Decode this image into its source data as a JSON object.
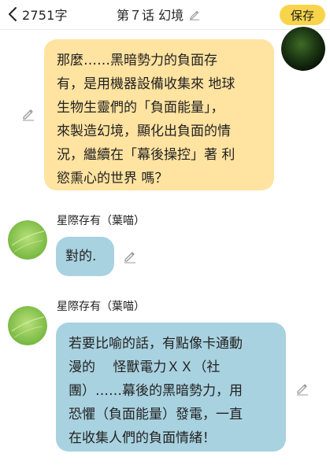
{
  "header": {
    "char_count": "2751字",
    "title": "第７话 幻境",
    "save_label": "保存"
  },
  "messages": [
    {
      "side": "right",
      "text": "那麼……黑暗勢力的負面存\n有，是用機器設備收集來 地球\n生物生靈們的「負面能量」，\n來製造幻境，顯化出負面的情\n況，繼續在「幕後操控」著 利\n慾熏心的世界 嗎？"
    },
    {
      "side": "left",
      "sender": "星際存有（葉喵）",
      "text": "對的."
    },
    {
      "side": "left",
      "sender": "星際存有（葉喵）",
      "text": "若要比喻的話，有點像卡通動\n漫的　 怪獸電力ＸＸ（社\n團）……幕後的黑暗勢力，用\n恐懼（負面能量）發電，一直\n在收集人們的負面情緒！"
    }
  ],
  "icons": {
    "back": "chevron-left-icon",
    "edit": "pencil-icon",
    "avatar_right": "dark-green-orb-avatar",
    "avatar_left": "green-leaf-avatar"
  },
  "colors": {
    "save_button": "#f7d44a",
    "bubble_right": "#ffe3a0",
    "bubble_left": "#a9d2e0"
  }
}
